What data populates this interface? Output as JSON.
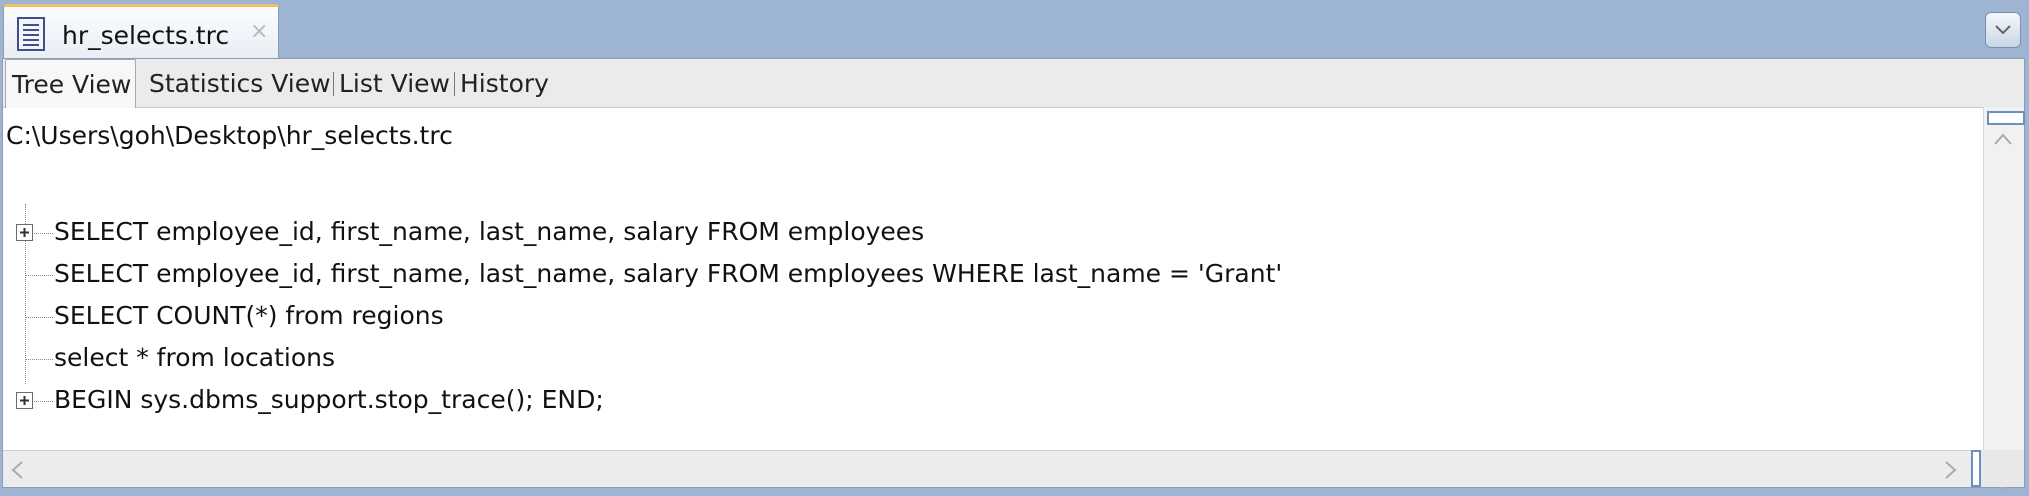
{
  "document_tab": {
    "label": "hr_selects.trc",
    "close_symbol": "×",
    "icon": "document-icon"
  },
  "subtabs": [
    "Tree View",
    "Statistics View",
    "List View",
    "History"
  ],
  "active_subtab": "Tree View",
  "tree": {
    "root_path": "C:\\Users\\goh\\Desktop\\hr_selects.trc",
    "items": [
      {
        "text": "SELECT employee_id, first_name, last_name, salary FROM employees",
        "expandable": true
      },
      {
        "text": "SELECT employee_id, first_name, last_name, salary FROM employees WHERE last_name = 'Grant'",
        "expandable": false
      },
      {
        "text": "SELECT COUNT(*) from regions",
        "expandable": false
      },
      {
        "text": "select * from locations",
        "expandable": false
      },
      {
        "text": "BEGIN sys.dbms_support.stop_trace(); END;",
        "expandable": true
      }
    ]
  },
  "colors": {
    "window_bg": "#9db5d3",
    "tab_accent": "#f0c060",
    "scroll_thumb": "#6b8fbe"
  }
}
